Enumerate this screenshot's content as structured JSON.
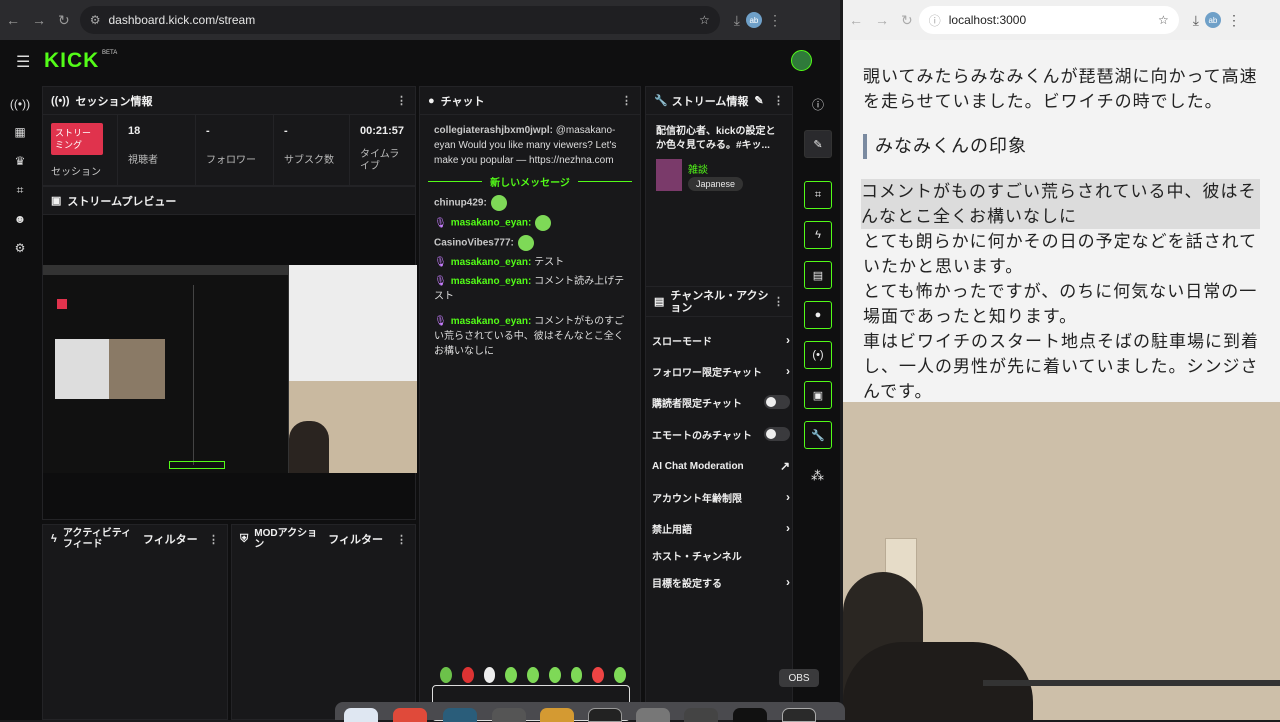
{
  "browser_left": {
    "url": "dashboard.kick.com/stream",
    "profile": "ab"
  },
  "browser_right": {
    "url": "localhost:3000"
  },
  "logo": "KICK",
  "logo_beta": "BETA",
  "session": {
    "title": "セッション情報",
    "status_button": "ストリー\nミング",
    "status_label": "セッション",
    "stats": [
      {
        "value": "18",
        "label": "視聴者"
      },
      {
        "value": "-",
        "label": "フォロワー"
      },
      {
        "value": "-",
        "label": "サブスク数"
      },
      {
        "value": "00:21:57",
        "label": "タイムライブ"
      }
    ]
  },
  "preview": {
    "title": "ストリームプレビュー"
  },
  "activity": {
    "title": "アクティビティフィード",
    "filter": "フィルター"
  },
  "mod": {
    "title": "MODアクション",
    "filter": "フィルター"
  },
  "chat": {
    "title": "チャット",
    "new_messages": "新しいメッセージ",
    "messages": [
      {
        "user": "collegiaterashjbxm0jwpl:",
        "text": " @masakano-eyan Would you like many viewers? Let's make you popular — https://nezhna.com"
      },
      {
        "user": "chinup429:",
        "text": ""
      },
      {
        "user": "masakano_eyan:",
        "text": ""
      },
      {
        "user": "CasinoVibes777:",
        "text": ""
      },
      {
        "user": "masakano_eyan:",
        "text": " テスト"
      },
      {
        "user": "masakano_eyan:",
        "text": " コメント読み上げテスト"
      },
      {
        "user": "masakano_eyan:",
        "text": " コメントがものすごい荒らされている中、彼はそんなとこ全くお構いなしに"
      }
    ]
  },
  "stream_info": {
    "title": "ストリーム情報",
    "stream_title": "配信初心者、kickの設定とか色々見てみる。#キッ...",
    "category": "雑談",
    "language": "Japanese"
  },
  "channel_actions": {
    "title": "チャンネル・アクション",
    "items": [
      {
        "label": "スローモード",
        "kind": "chevron"
      },
      {
        "label": "フォロワー限定チャット",
        "kind": "chevron"
      },
      {
        "label": "購読者限定チャット",
        "kind": "toggle"
      },
      {
        "label": "エモートのみチャット",
        "kind": "toggle"
      },
      {
        "label": "AI Chat Moderation",
        "kind": "external"
      },
      {
        "label": "アカウント年齢制限",
        "kind": "chevron"
      },
      {
        "label": "禁止用語",
        "kind": "chevron"
      },
      {
        "label": "ホスト・チャンネル",
        "kind": "none"
      },
      {
        "label": "目標を設定する",
        "kind": "chevron"
      }
    ]
  },
  "doc": {
    "para1": "覗いてみたらみなみくんが琵琶湖に向かって高速を走らせていました。ビワイチの時でした。",
    "heading": "みなみくんの印象",
    "highlight": "コメントがものすごい荒らされている中、彼はそんなとこ全くお構いなしに",
    "para2": "とても朗らかに何かその日の予定などを話されていたかと思います。",
    "para3": "とても怖かったですが、のちに何気ない日常の一場面であったと知ります。",
    "para4": "車はビワイチのスタート地点そばの駐車場に到着し、一人の男性が先に着いていました。シンジさんです。"
  },
  "tooltip": "OBS",
  "colors": {
    "kick_green": "#53fc18",
    "live_red": "#e0334d"
  }
}
